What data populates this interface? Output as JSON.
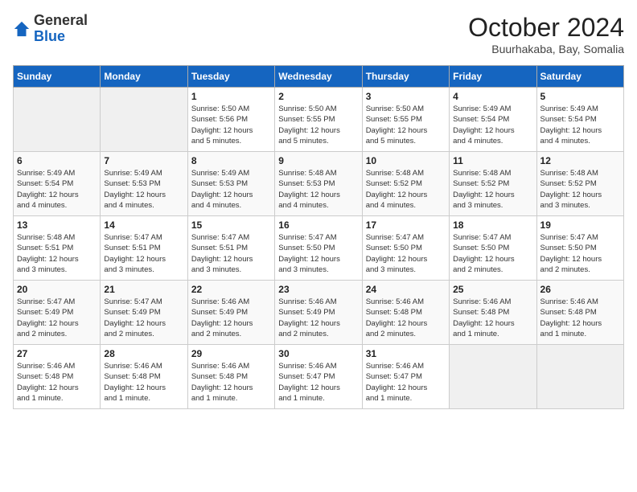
{
  "header": {
    "logo": {
      "line1": "General",
      "line2": "Blue"
    },
    "title": "October 2024",
    "location": "Buurhakaba, Bay, Somalia"
  },
  "days_of_week": [
    "Sunday",
    "Monday",
    "Tuesday",
    "Wednesday",
    "Thursday",
    "Friday",
    "Saturday"
  ],
  "weeks": [
    [
      {
        "day": "",
        "info": ""
      },
      {
        "day": "",
        "info": ""
      },
      {
        "day": "1",
        "info": "Sunrise: 5:50 AM\nSunset: 5:56 PM\nDaylight: 12 hours\nand 5 minutes."
      },
      {
        "day": "2",
        "info": "Sunrise: 5:50 AM\nSunset: 5:55 PM\nDaylight: 12 hours\nand 5 minutes."
      },
      {
        "day": "3",
        "info": "Sunrise: 5:50 AM\nSunset: 5:55 PM\nDaylight: 12 hours\nand 5 minutes."
      },
      {
        "day": "4",
        "info": "Sunrise: 5:49 AM\nSunset: 5:54 PM\nDaylight: 12 hours\nand 4 minutes."
      },
      {
        "day": "5",
        "info": "Sunrise: 5:49 AM\nSunset: 5:54 PM\nDaylight: 12 hours\nand 4 minutes."
      }
    ],
    [
      {
        "day": "6",
        "info": "Sunrise: 5:49 AM\nSunset: 5:54 PM\nDaylight: 12 hours\nand 4 minutes."
      },
      {
        "day": "7",
        "info": "Sunrise: 5:49 AM\nSunset: 5:53 PM\nDaylight: 12 hours\nand 4 minutes."
      },
      {
        "day": "8",
        "info": "Sunrise: 5:49 AM\nSunset: 5:53 PM\nDaylight: 12 hours\nand 4 minutes."
      },
      {
        "day": "9",
        "info": "Sunrise: 5:48 AM\nSunset: 5:53 PM\nDaylight: 12 hours\nand 4 minutes."
      },
      {
        "day": "10",
        "info": "Sunrise: 5:48 AM\nSunset: 5:52 PM\nDaylight: 12 hours\nand 4 minutes."
      },
      {
        "day": "11",
        "info": "Sunrise: 5:48 AM\nSunset: 5:52 PM\nDaylight: 12 hours\nand 3 minutes."
      },
      {
        "day": "12",
        "info": "Sunrise: 5:48 AM\nSunset: 5:52 PM\nDaylight: 12 hours\nand 3 minutes."
      }
    ],
    [
      {
        "day": "13",
        "info": "Sunrise: 5:48 AM\nSunset: 5:51 PM\nDaylight: 12 hours\nand 3 minutes."
      },
      {
        "day": "14",
        "info": "Sunrise: 5:47 AM\nSunset: 5:51 PM\nDaylight: 12 hours\nand 3 minutes."
      },
      {
        "day": "15",
        "info": "Sunrise: 5:47 AM\nSunset: 5:51 PM\nDaylight: 12 hours\nand 3 minutes."
      },
      {
        "day": "16",
        "info": "Sunrise: 5:47 AM\nSunset: 5:50 PM\nDaylight: 12 hours\nand 3 minutes."
      },
      {
        "day": "17",
        "info": "Sunrise: 5:47 AM\nSunset: 5:50 PM\nDaylight: 12 hours\nand 3 minutes."
      },
      {
        "day": "18",
        "info": "Sunrise: 5:47 AM\nSunset: 5:50 PM\nDaylight: 12 hours\nand 2 minutes."
      },
      {
        "day": "19",
        "info": "Sunrise: 5:47 AM\nSunset: 5:50 PM\nDaylight: 12 hours\nand 2 minutes."
      }
    ],
    [
      {
        "day": "20",
        "info": "Sunrise: 5:47 AM\nSunset: 5:49 PM\nDaylight: 12 hours\nand 2 minutes."
      },
      {
        "day": "21",
        "info": "Sunrise: 5:47 AM\nSunset: 5:49 PM\nDaylight: 12 hours\nand 2 minutes."
      },
      {
        "day": "22",
        "info": "Sunrise: 5:46 AM\nSunset: 5:49 PM\nDaylight: 12 hours\nand 2 minutes."
      },
      {
        "day": "23",
        "info": "Sunrise: 5:46 AM\nSunset: 5:49 PM\nDaylight: 12 hours\nand 2 minutes."
      },
      {
        "day": "24",
        "info": "Sunrise: 5:46 AM\nSunset: 5:48 PM\nDaylight: 12 hours\nand 2 minutes."
      },
      {
        "day": "25",
        "info": "Sunrise: 5:46 AM\nSunset: 5:48 PM\nDaylight: 12 hours\nand 1 minute."
      },
      {
        "day": "26",
        "info": "Sunrise: 5:46 AM\nSunset: 5:48 PM\nDaylight: 12 hours\nand 1 minute."
      }
    ],
    [
      {
        "day": "27",
        "info": "Sunrise: 5:46 AM\nSunset: 5:48 PM\nDaylight: 12 hours\nand 1 minute."
      },
      {
        "day": "28",
        "info": "Sunrise: 5:46 AM\nSunset: 5:48 PM\nDaylight: 12 hours\nand 1 minute."
      },
      {
        "day": "29",
        "info": "Sunrise: 5:46 AM\nSunset: 5:48 PM\nDaylight: 12 hours\nand 1 minute."
      },
      {
        "day": "30",
        "info": "Sunrise: 5:46 AM\nSunset: 5:47 PM\nDaylight: 12 hours\nand 1 minute."
      },
      {
        "day": "31",
        "info": "Sunrise: 5:46 AM\nSunset: 5:47 PM\nDaylight: 12 hours\nand 1 minute."
      },
      {
        "day": "",
        "info": ""
      },
      {
        "day": "",
        "info": ""
      }
    ]
  ]
}
